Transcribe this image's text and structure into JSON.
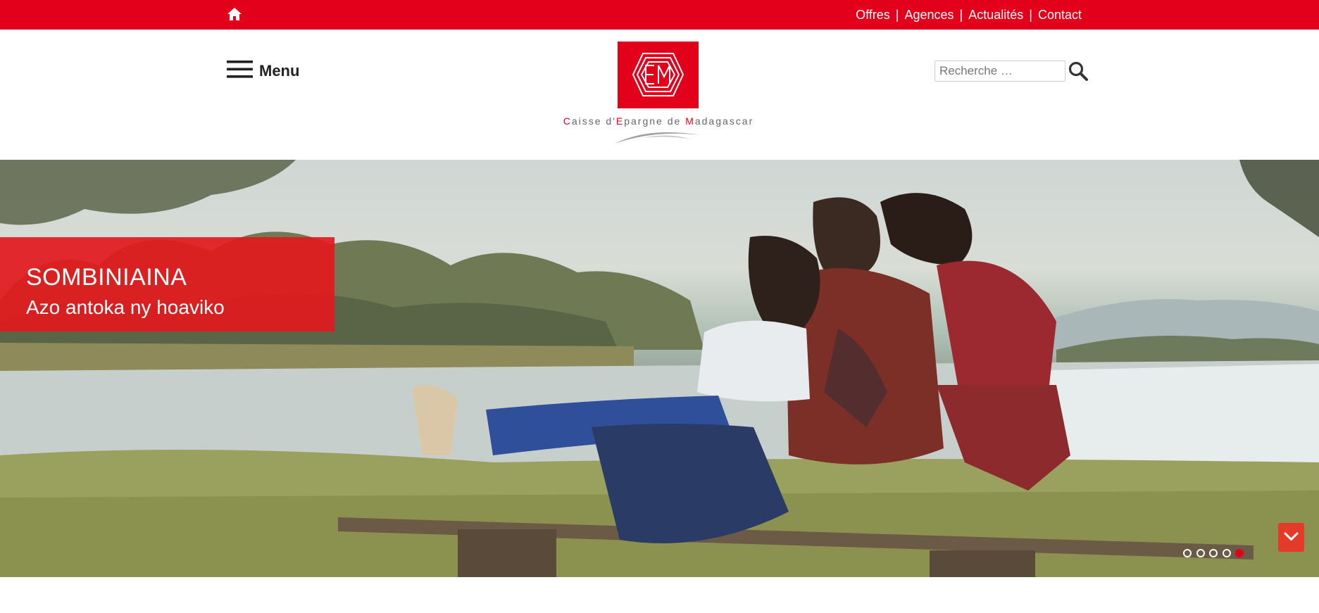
{
  "topbar": {
    "home_icon": "home-icon",
    "links": [
      "Offres",
      "Agences",
      "Actualités",
      "Contact"
    ],
    "separator": "|",
    "background": "#e2001a"
  },
  "header": {
    "menu_icon": "hamburger-icon",
    "menu_label": "Menu",
    "logo": {
      "monogram": "CEM",
      "name_parts": [
        {
          "text": "C",
          "accent": true
        },
        {
          "text": "aisse d'",
          "accent": false
        },
        {
          "text": "E",
          "accent": true
        },
        {
          "text": "pargne de ",
          "accent": false
        },
        {
          "text": "M",
          "accent": true
        },
        {
          "text": "adagascar",
          "accent": false
        }
      ]
    },
    "search": {
      "placeholder": "Recherche …",
      "value": "",
      "button_icon": "search-icon"
    }
  },
  "hero": {
    "title": "SOMBINIAINA",
    "subtitle": "Azo antoka ny hoaviko",
    "slides_total": 5,
    "active_slide": 5,
    "scroll_icon": "chevron-down-icon",
    "accent": "#e2001a"
  }
}
